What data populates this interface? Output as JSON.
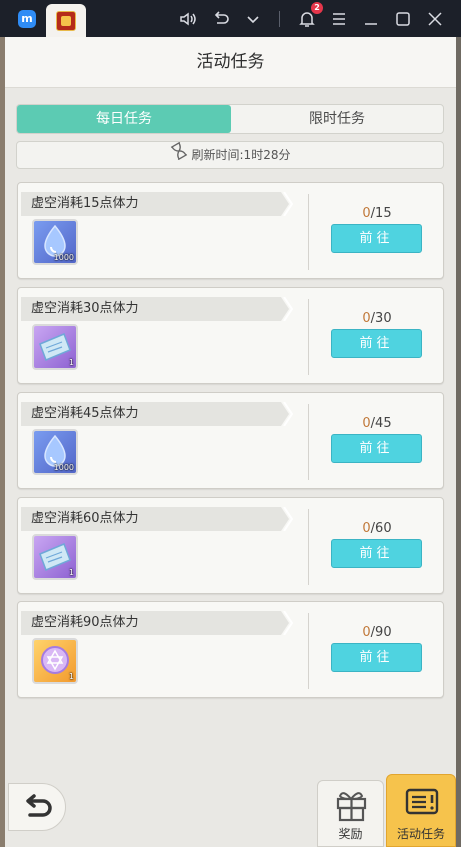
{
  "toolbar": {
    "notification_count": "2",
    "icons": [
      "app-logo-icon",
      "game-tab-icon",
      "volume-icon",
      "undo-icon",
      "chevron-down-icon",
      "bell-icon",
      "menu-icon",
      "minimize-icon",
      "maximize-icon",
      "close-icon"
    ]
  },
  "header": {
    "title": "活动任务"
  },
  "tabs": {
    "daily": "每日任务",
    "limited": "限时任务"
  },
  "refresh": {
    "text": "刷新时间:1时28分"
  },
  "tasks": [
    {
      "label": "虚空消耗15点体力",
      "current": "0",
      "total": "/15",
      "item_count": "1000",
      "item": "stamina-potion",
      "button": "前往"
    },
    {
      "label": "虚空消耗30点体力",
      "current": "0",
      "total": "/30",
      "item_count": "1",
      "item": "ticket",
      "button": "前往"
    },
    {
      "label": "虚空消耗45点体力",
      "current": "0",
      "total": "/45",
      "item_count": "1000",
      "item": "stamina-potion",
      "button": "前往"
    },
    {
      "label": "虚空消耗60点体力",
      "current": "0",
      "total": "/60",
      "item_count": "1",
      "item": "ticket",
      "button": "前往"
    },
    {
      "label": "虚空消耗90点体力",
      "current": "0",
      "total": "/90",
      "item_count": "1",
      "item": "star-coin",
      "button": "前往"
    }
  ],
  "nav": {
    "reward": "奖励",
    "activity_tasks": "活动任务"
  },
  "colors": {
    "tab_active": "#5ccbb3",
    "go_button": "#4fd3e0",
    "nav_active": "#f6c34c",
    "progress_current": "#c1793a"
  }
}
